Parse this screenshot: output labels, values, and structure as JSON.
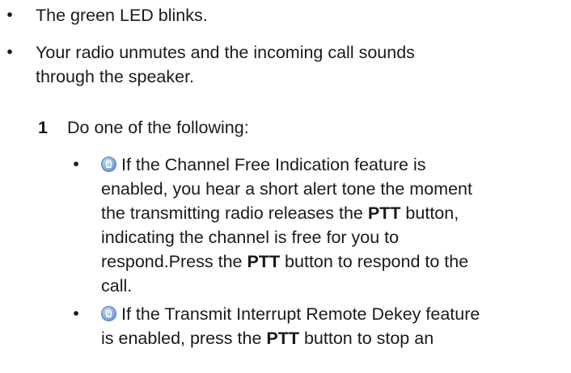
{
  "bullets_top": [
    "The green LED blinks.",
    "Your radio unmutes and the incoming call sounds\nthrough the speaker."
  ],
  "step": {
    "number": "1",
    "text": "Do one of the following:"
  },
  "sub_bullets": [
    {
      "icon": "radio-feature-icon",
      "parts": [
        "If the Channel Free Indication feature is\nenabled, you hear a short alert tone the moment\nthe transmitting radio releases the ",
        "PTT",
        " button,\nindicating the channel is free for you to\nrespond.Press the ",
        "PTT",
        " button to respond to the\ncall."
      ]
    },
    {
      "icon": "radio-feature-icon",
      "parts": [
        "If the Transmit Interrupt Remote Dekey feature\nis enabled, press the ",
        "PTT",
        " button to stop an"
      ]
    }
  ]
}
